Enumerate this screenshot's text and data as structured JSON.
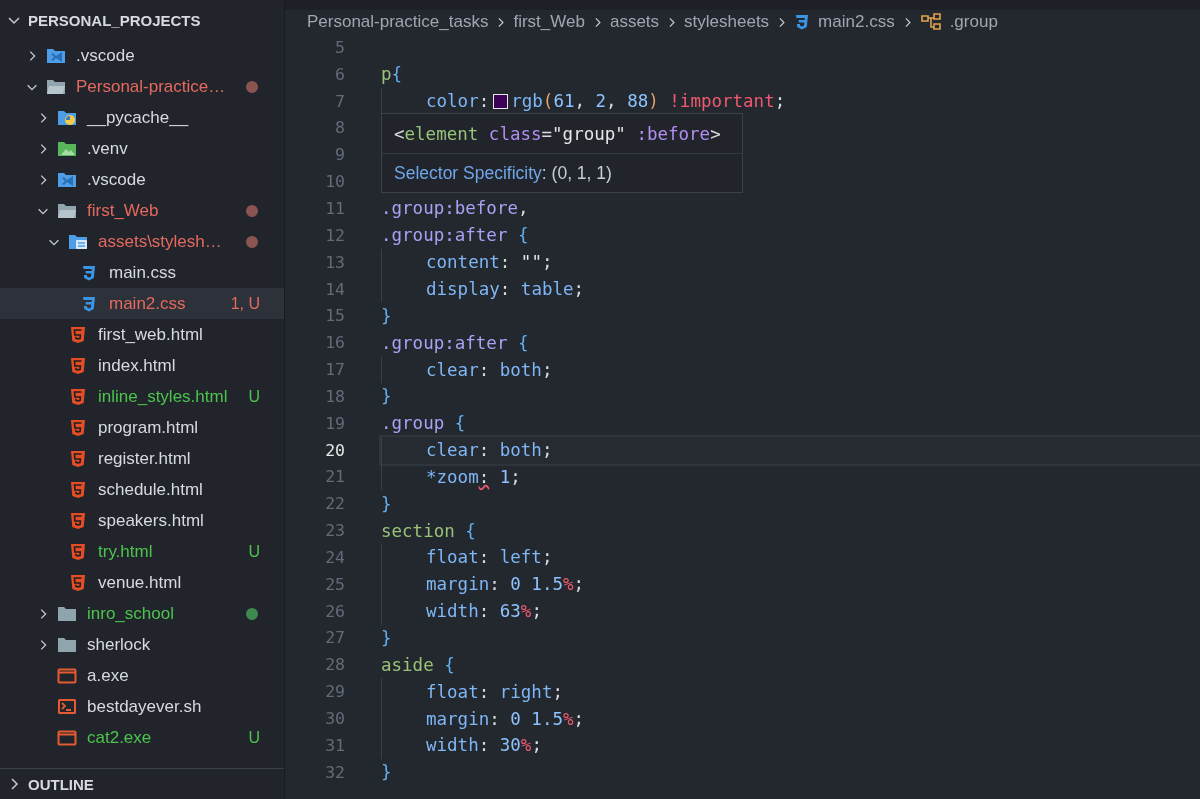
{
  "explorer": {
    "title": "PERSONAL_PROJECTS",
    "expanded": true,
    "items": [
      {
        "label": ".vscode",
        "kind": "vscode-folder",
        "expanded": false,
        "modified": false,
        "untracked": false
      },
      {
        "label": "Personal-practice…",
        "kind": "folder-open",
        "expanded": true,
        "modified": true,
        "untracked": false,
        "dot": true,
        "children": [
          {
            "label": "__pycache__",
            "kind": "python-folder",
            "expanded": false,
            "modified": false,
            "untracked": false
          },
          {
            "label": ".venv",
            "kind": "venv-folder",
            "expanded": false,
            "modified": false,
            "untracked": false
          },
          {
            "label": ".vscode",
            "kind": "vscode-folder",
            "expanded": false,
            "modified": false,
            "untracked": false
          },
          {
            "label": "first_Web",
            "kind": "folder-open",
            "expanded": true,
            "modified": true,
            "untracked": false,
            "dot": true,
            "children": [
              {
                "label": "assets\\stylesh…",
                "kind": "assets-folder",
                "expanded": true,
                "modified": true,
                "untracked": false,
                "dot": true,
                "children": [
                  {
                    "label": "main.css",
                    "kind": "css",
                    "modified": false,
                    "untracked": false,
                    "selected": false
                  },
                  {
                    "label": "main2.css",
                    "kind": "css",
                    "modified": true,
                    "untracked": false,
                    "badge": "1, U",
                    "selected": true
                  }
                ]
              },
              {
                "label": "first_web.html",
                "kind": "html",
                "modified": false,
                "untracked": false,
                "selected": false
              },
              {
                "label": "index.html",
                "kind": "html",
                "modified": false,
                "untracked": false,
                "selected": false
              },
              {
                "label": "inline_styles.html",
                "kind": "html",
                "modified": false,
                "untracked": true,
                "badge": "U",
                "selected": false
              },
              {
                "label": "program.html",
                "kind": "html",
                "modified": false,
                "untracked": false,
                "selected": false
              },
              {
                "label": "register.html",
                "kind": "html",
                "modified": false,
                "untracked": false,
                "selected": false
              },
              {
                "label": "schedule.html",
                "kind": "html",
                "modified": false,
                "untracked": false,
                "selected": false
              },
              {
                "label": "speakers.html",
                "kind": "html",
                "modified": false,
                "untracked": false,
                "selected": false
              },
              {
                "label": "try.html",
                "kind": "html",
                "modified": false,
                "untracked": true,
                "badge": "U",
                "selected": false
              },
              {
                "label": "venue.html",
                "kind": "html",
                "modified": false,
                "untracked": false,
                "selected": false
              }
            ]
          },
          {
            "label": "inro_school",
            "kind": "folder",
            "expanded": false,
            "modified": false,
            "untracked": true,
            "dot": true
          },
          {
            "label": "sherlock",
            "kind": "folder",
            "expanded": false,
            "modified": false,
            "untracked": false
          },
          {
            "label": "a.exe",
            "kind": "exe",
            "modified": false,
            "untracked": false,
            "selected": false
          },
          {
            "label": "bestdayever.sh",
            "kind": "shell",
            "modified": false,
            "untracked": false,
            "selected": false
          },
          {
            "label": "cat2.exe",
            "kind": "exe",
            "modified": false,
            "untracked": true,
            "badge": "U",
            "selected": false
          }
        ]
      }
    ]
  },
  "outline": {
    "title": "OUTLINE",
    "expanded": false
  },
  "breadcrumbs": [
    {
      "label": "Personal-practice_tasks",
      "kind": "folder"
    },
    {
      "label": "first_Web",
      "kind": "folder"
    },
    {
      "label": "assets",
      "kind": "folder"
    },
    {
      "label": "stylesheets",
      "kind": "folder"
    },
    {
      "label": "main2.css",
      "kind": "css"
    },
    {
      "label": ".group",
      "kind": "symbol"
    }
  ],
  "editor": {
    "lines": [
      {
        "number": "5",
        "indented": false,
        "current": false
      },
      {
        "number": "6",
        "indented": false,
        "current": false,
        "tokens": [
          {
            "text": "p",
            "kind": "sel"
          },
          {
            "text": "{",
            "kind": "brace"
          }
        ]
      },
      {
        "number": "7",
        "indented": true,
        "current": false,
        "tokens": [
          {
            "text": "color",
            "kind": "prop"
          },
          {
            "text": ":",
            "kind": "punct"
          },
          {
            "kind": "swatch",
            "color": "#3d0258"
          },
          {
            "text": "rgb",
            "kind": "fn"
          },
          {
            "text": "(",
            "kind": "paren"
          },
          {
            "text": "61",
            "kind": "num"
          },
          {
            "text": ", ",
            "kind": "punct"
          },
          {
            "text": "2",
            "kind": "num"
          },
          {
            "text": ", ",
            "kind": "punct"
          },
          {
            "text": "88",
            "kind": "num"
          },
          {
            "text": ")",
            "kind": "paren"
          },
          {
            "text": " !important",
            "kind": "imp"
          },
          {
            "text": ";",
            "kind": "punct"
          }
        ]
      },
      {
        "number": "8",
        "indented": false,
        "current": false
      },
      {
        "number": "9",
        "indented": false,
        "current": false
      },
      {
        "number": "10",
        "indented": false,
        "current": false
      },
      {
        "number": "11",
        "indented": false,
        "current": false,
        "tokens": [
          {
            "text": ".group:before",
            "kind": "cls"
          },
          {
            "text": ",",
            "kind": "punct"
          }
        ]
      },
      {
        "number": "12",
        "indented": false,
        "current": false,
        "tokens": [
          {
            "text": ".group:after ",
            "kind": "cls"
          },
          {
            "text": "{",
            "kind": "brace"
          }
        ]
      },
      {
        "number": "13",
        "indented": true,
        "current": false,
        "tokens": [
          {
            "text": "content",
            "kind": "prop"
          },
          {
            "text": ": ",
            "kind": "punct"
          },
          {
            "text": "\"\"",
            "kind": "str"
          },
          {
            "text": ";",
            "kind": "punct"
          }
        ]
      },
      {
        "number": "14",
        "indented": true,
        "current": false,
        "tokens": [
          {
            "text": "display",
            "kind": "prop"
          },
          {
            "text": ": ",
            "kind": "punct"
          },
          {
            "text": "table",
            "kind": "val"
          },
          {
            "text": ";",
            "kind": "punct"
          }
        ]
      },
      {
        "number": "15",
        "indented": false,
        "current": false,
        "tokens": [
          {
            "text": "}",
            "kind": "brace"
          }
        ]
      },
      {
        "number": "16",
        "indented": false,
        "current": false,
        "tokens": [
          {
            "text": ".group:after ",
            "kind": "cls"
          },
          {
            "text": "{",
            "kind": "brace"
          }
        ]
      },
      {
        "number": "17",
        "indented": true,
        "current": false,
        "tokens": [
          {
            "text": "clear",
            "kind": "prop"
          },
          {
            "text": ": ",
            "kind": "punct"
          },
          {
            "text": "both",
            "kind": "val"
          },
          {
            "text": ";",
            "kind": "punct"
          }
        ]
      },
      {
        "number": "18",
        "indented": false,
        "current": false,
        "tokens": [
          {
            "text": "}",
            "kind": "brace"
          }
        ]
      },
      {
        "number": "19",
        "indented": false,
        "current": false,
        "tokens": [
          {
            "text": ".group ",
            "kind": "cls"
          },
          {
            "text": "{",
            "kind": "brace"
          }
        ]
      },
      {
        "number": "20",
        "indented": true,
        "current": true,
        "tokens": [
          {
            "text": "clear",
            "kind": "prop"
          },
          {
            "text": ": ",
            "kind": "punct"
          },
          {
            "text": "both",
            "kind": "val"
          },
          {
            "text": ";",
            "kind": "punct"
          }
        ]
      },
      {
        "number": "21",
        "indented": true,
        "current": false,
        "tokens": [
          {
            "text": "*zoom",
            "kind": "prop"
          },
          {
            "text": ":",
            "kind": "error"
          },
          {
            "text": " 1",
            "kind": "num"
          },
          {
            "text": ";",
            "kind": "punct"
          }
        ]
      },
      {
        "number": "22",
        "indented": false,
        "current": false,
        "tokens": [
          {
            "text": "}",
            "kind": "brace"
          }
        ]
      },
      {
        "number": "23",
        "indented": false,
        "current": false,
        "tokens": [
          {
            "text": "section ",
            "kind": "sel"
          },
          {
            "text": "{",
            "kind": "brace"
          }
        ]
      },
      {
        "number": "24",
        "indented": true,
        "current": false,
        "tokens": [
          {
            "text": "float",
            "kind": "prop"
          },
          {
            "text": ": ",
            "kind": "punct"
          },
          {
            "text": "left",
            "kind": "val"
          },
          {
            "text": ";",
            "kind": "punct"
          }
        ]
      },
      {
        "number": "25",
        "indented": true,
        "current": false,
        "tokens": [
          {
            "text": "margin",
            "kind": "prop"
          },
          {
            "text": ": ",
            "kind": "punct"
          },
          {
            "text": "0 1.5",
            "kind": "num"
          },
          {
            "text": "%",
            "kind": "unit"
          },
          {
            "text": ";",
            "kind": "punct"
          }
        ]
      },
      {
        "number": "26",
        "indented": true,
        "current": false,
        "tokens": [
          {
            "text": "width",
            "kind": "prop"
          },
          {
            "text": ": ",
            "kind": "punct"
          },
          {
            "text": "63",
            "kind": "num"
          },
          {
            "text": "%",
            "kind": "unit"
          },
          {
            "text": ";",
            "kind": "punct"
          }
        ]
      },
      {
        "number": "27",
        "indented": false,
        "current": false,
        "tokens": [
          {
            "text": "}",
            "kind": "brace"
          }
        ]
      },
      {
        "number": "28",
        "indented": false,
        "current": false,
        "tokens": [
          {
            "text": "aside ",
            "kind": "sel"
          },
          {
            "text": "{",
            "kind": "brace"
          }
        ]
      },
      {
        "number": "29",
        "indented": true,
        "current": false,
        "tokens": [
          {
            "text": "float",
            "kind": "prop"
          },
          {
            "text": ": ",
            "kind": "punct"
          },
          {
            "text": "right",
            "kind": "val"
          },
          {
            "text": ";",
            "kind": "punct"
          }
        ]
      },
      {
        "number": "30",
        "indented": true,
        "current": false,
        "tokens": [
          {
            "text": "margin",
            "kind": "prop"
          },
          {
            "text": ": ",
            "kind": "punct"
          },
          {
            "text": "0 1.5",
            "kind": "num"
          },
          {
            "text": "%",
            "kind": "unit"
          },
          {
            "text": ";",
            "kind": "punct"
          }
        ]
      },
      {
        "number": "31",
        "indented": true,
        "current": false,
        "tokens": [
          {
            "text": "width",
            "kind": "prop"
          },
          {
            "text": ": ",
            "kind": "punct"
          },
          {
            "text": "30",
            "kind": "num"
          },
          {
            "text": "%",
            "kind": "unit"
          },
          {
            "text": ";",
            "kind": "punct"
          }
        ]
      },
      {
        "number": "32",
        "indented": false,
        "current": false,
        "tokens": [
          {
            "text": "}",
            "kind": "brace"
          }
        ]
      }
    ]
  },
  "hover": {
    "tokens": [
      {
        "text": "<",
        "kind": "punct"
      },
      {
        "text": "element ",
        "kind": "tag"
      },
      {
        "text": "class",
        "kind": "attr"
      },
      {
        "text": "=",
        "kind": "punct"
      },
      {
        "text": "\"group\" ",
        "kind": "str"
      },
      {
        "text": ":before",
        "kind": "attr"
      },
      {
        "text": ">",
        "kind": "punct"
      }
    ],
    "link": "Selector Specificity",
    "detail": ": (0, 1, 1)"
  }
}
